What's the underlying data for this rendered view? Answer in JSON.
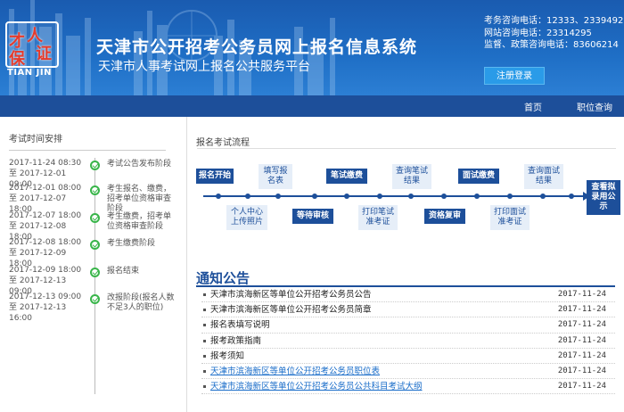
{
  "header": {
    "logo_text": "人才保证",
    "logo_en": "TIAN JIN",
    "title": "天津市公开招考公务员网上报名信息系统",
    "subtitle": "天津市人事考试网上报名公共服务平台",
    "contacts": [
      {
        "label": "考务咨询电话：",
        "value": "12333、23394926"
      },
      {
        "label": "网站咨询电话：",
        "value": "23314295"
      },
      {
        "label": "监督、政策咨询电话：",
        "value": "83606214"
      }
    ],
    "login_button": "注册登录"
  },
  "nav": {
    "home": "首页",
    "position_search": "职位查询"
  },
  "schedule": {
    "title": "考试时间安排",
    "items": [
      {
        "date": "2017-11-24 08:30 至 2017-12-01 09:00",
        "desc": "考试公告发布阶段"
      },
      {
        "date": "2017-12-01 08:00 至 2017-12-07 18:00",
        "desc": "考生报名、缴费，招考单位资格审查阶段"
      },
      {
        "date": "2017-12-07 18:00 至 2017-12-08 18:00",
        "desc": "考生缴费，招考单位资格审查阶段"
      },
      {
        "date": "2017-12-08 18:00 至 2017-12-09 18:00",
        "desc": "考生缴费阶段"
      },
      {
        "date": "2017-12-09 18:00 至 2017-12-13 09:00",
        "desc": "报名结束"
      },
      {
        "date": "2017-12-13 09:00 至 2017-12-13 16:00",
        "desc": "改报阶段(报名人数不足3人的职位)"
      }
    ]
  },
  "flow": {
    "title": "报名考试流程",
    "steps": {
      "start": "报名开始",
      "fill_form": "填写报名表",
      "upload_photo": "个人中心上传照片",
      "await_review": "等待审核",
      "written_fee": "笔试缴费",
      "print_written": "打印笔试准考证",
      "query_written": "查询笔试结果",
      "recheck": "资格复审",
      "interview_fee": "面试缴费",
      "print_interview": "打印面试准考证",
      "query_interview": "查询面试结果",
      "view_hired": "查看拟录用公示"
    }
  },
  "notices": {
    "title": "通知公告",
    "items": [
      {
        "title": "天津市滨海新区等单位公开招考公务员公告",
        "date": "2017-11-24",
        "link": false
      },
      {
        "title": "天津市滨海新区等单位公开招考公务员简章",
        "date": "2017-11-24",
        "link": false
      },
      {
        "title": "报名表填写说明",
        "date": "2017-11-24",
        "link": false
      },
      {
        "title": "报考政策指南",
        "date": "2017-11-24",
        "link": false
      },
      {
        "title": "报考须知",
        "date": "2017-11-24",
        "link": false
      },
      {
        "title": "天津市滨海新区等单位公开招考公务员职位表",
        "date": "2017-11-24",
        "link": true
      },
      {
        "title": "天津市滨海新区等单位公开招考公务员公共科目考试大纲",
        "date": "2017-11-24",
        "link": true
      }
    ]
  },
  "colors": {
    "brand": "#1d4f9a",
    "header": "#1f6fc6",
    "check": "#39b54a",
    "link": "#1a6dc9"
  }
}
